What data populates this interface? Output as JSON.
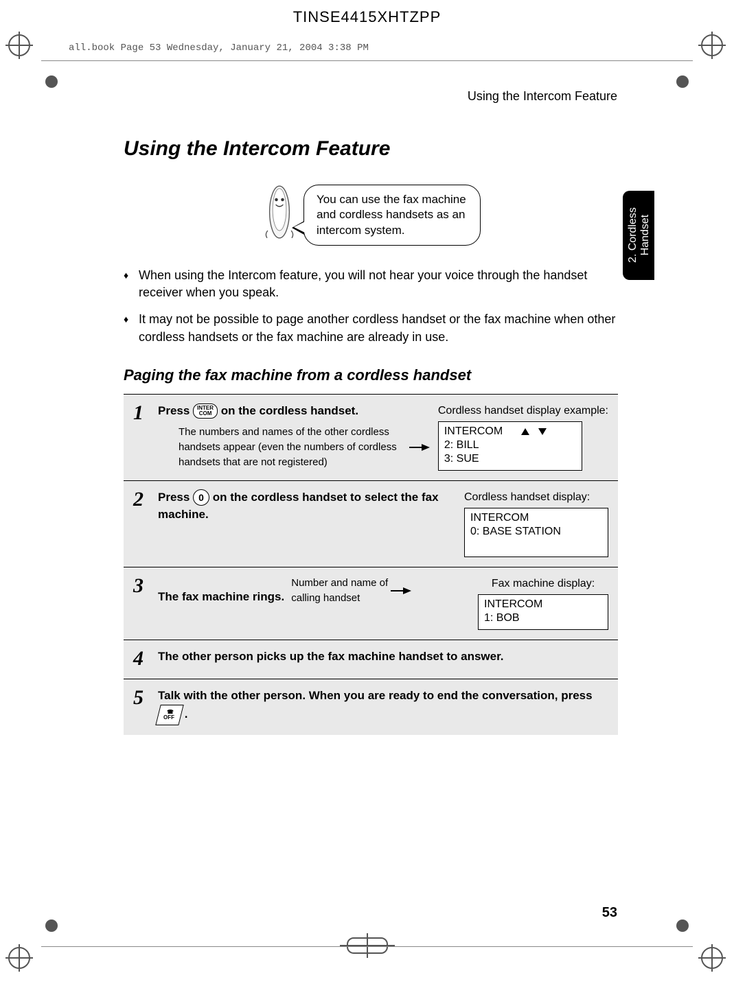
{
  "doc_code": "TINSE4415XHTZPP",
  "book_info": "all.book  Page 53  Wednesday, January 21, 2004  3:38 PM",
  "running_head": "Using the Intercom Feature",
  "side_tab": "2. Cordless\nHandset",
  "title": "Using the Intercom Feature",
  "speech": "You can use the fax machine and cordless handsets as an intercom system.",
  "bullets": [
    "When using the Intercom feature, you will not hear your voice through the handset receiver when you speak.",
    "It may not be possible to page another cordless handset or the fax machine when other cordless handsets or the fax machine are already in use."
  ],
  "subheading": "Paging the fax machine from a cordless handset",
  "steps": {
    "s1": {
      "num": "1",
      "text_a": "Press ",
      "key_label_top": "INTER",
      "key_label_bot": "COM",
      "text_b": " on the cordless handset.",
      "sub_note": "The numbers and names of the other cordless handsets appear (even the numbers of cordless handsets that are not registered)",
      "disp_label": "Cordless handset display example:",
      "disp_line1": "INTERCOM",
      "disp_line2": "2: BILL",
      "disp_line3": "3: SUE"
    },
    "s2": {
      "num": "2",
      "text_a": "Press ",
      "key_label": "0",
      "text_b": " on the cordless handset to select the fax machine.",
      "disp_label": "Cordless handset display:",
      "disp_line1": "INTERCOM",
      "disp_line2": "0: BASE STATION"
    },
    "s3": {
      "num": "3",
      "text": "The fax machine rings.",
      "sub_note": "Number and name of calling handset",
      "disp_label": "Fax machine display:",
      "disp_line1": "INTERCOM",
      "disp_line2": "1: BOB"
    },
    "s4": {
      "num": "4",
      "text": "The other person picks up the fax machine handset to answer."
    },
    "s5": {
      "num": "5",
      "text_a": "Talk with the other person. When you are ready to end the conversation, press ",
      "key_icon": "☎",
      "key_label": "OFF",
      "text_b": "."
    }
  },
  "page_number": "53"
}
